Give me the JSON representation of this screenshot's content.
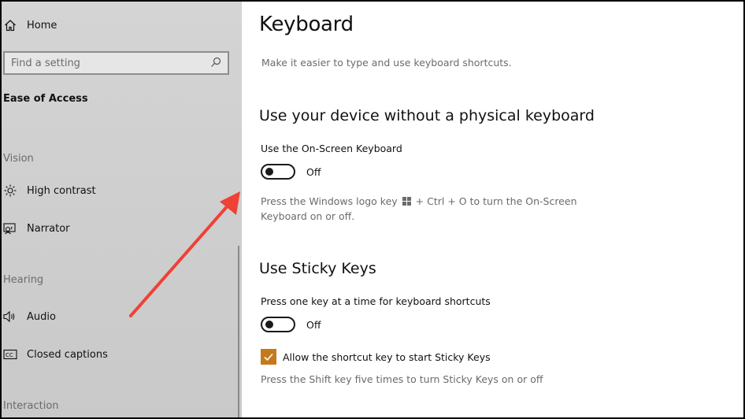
{
  "sidebar": {
    "home_label": "Home",
    "search_placeholder": "Find a setting",
    "section_title": "Ease of Access",
    "groups": {
      "vision": "Vision",
      "hearing": "Hearing",
      "interaction": "Interaction"
    },
    "items": [
      {
        "label": "High contrast",
        "icon": "sun-icon"
      },
      {
        "label": "Narrator",
        "icon": "narrator-icon"
      },
      {
        "label": "Audio",
        "icon": "speaker-icon"
      },
      {
        "label": "Closed captions",
        "icon": "cc-icon"
      }
    ]
  },
  "main": {
    "title": "Keyboard",
    "subtitle": "Make it easier to type and use keyboard shortcuts.",
    "osk": {
      "heading": "Use your device without a physical keyboard",
      "toggle_label": "Use the On-Screen Keyboard",
      "toggle_state": "Off",
      "hint_part1": "Press the Windows logo key",
      "hint_part2": "+ Ctrl + O to turn the On-Screen",
      "hint_line2": "Keyboard on or off."
    },
    "sticky": {
      "heading": "Use Sticky Keys",
      "toggle_label": "Press one key at a time for keyboard shortcuts",
      "toggle_state": "Off",
      "checkbox_label": "Allow the shortcut key to start Sticky Keys",
      "checkbox_checked": true,
      "hint": "Press the Shift key five times to turn Sticky Keys on or off"
    }
  },
  "colors": {
    "accent_checkbox": "#c47a1a",
    "annotation_arrow": "#ef4136"
  }
}
